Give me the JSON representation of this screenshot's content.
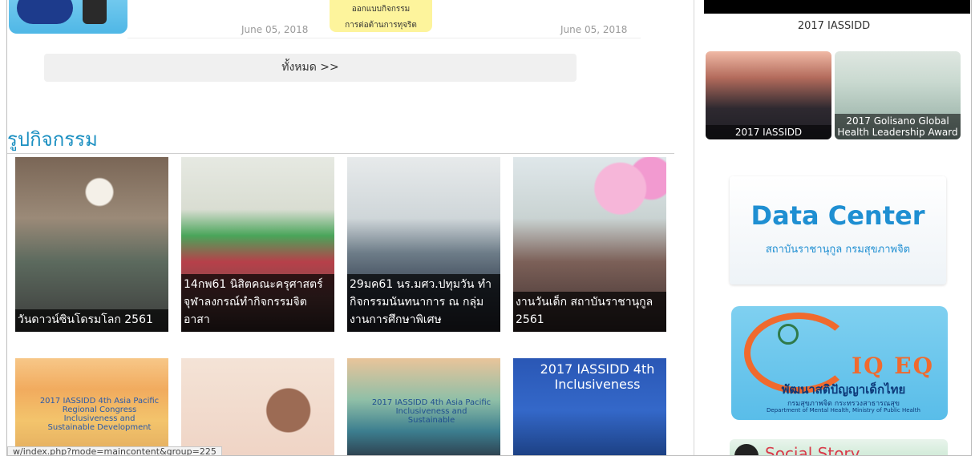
{
  "news": {
    "date_left": "June 05, 2018",
    "date_right": "June 05, 2018",
    "badge_line1": "ออกแบบกิจกรรม",
    "badge_line2": "การต่อต้านการทุจริต"
  },
  "all_button": "ทั้งหมด >>",
  "section_title": "รูปกิจกรรม",
  "gallery": {
    "row1": [
      {
        "caption": "วันดาวน์ซินโดรมโลก 2561"
      },
      {
        "caption": "14กพ61 นิสิตคณะครุศาสตร์ จุฬาลงกรณ์ทำกิจกรรมจิตอาสา"
      },
      {
        "caption": "29มค61 นร.มศว.ปทุมวัน ทำกิจกรรมนันทนาการ ณ กลุ่มงานการศึกษาพิเศษ"
      },
      {
        "caption": "งานวันเด็ก สถาบันราชานุกูล 2561"
      }
    ],
    "row2_banner_texts": [
      "2017 IASSIDD 4th Asia Pacific Regional Congress Inclusiveness and Sustainable Development",
      "2017 IASSIDD 4th Asia Pacific Inclusiveness and Sustainable",
      "2017 IASSIDD 4th Inclusiveness"
    ]
  },
  "sidebar": {
    "title": "2017 IASSIDD",
    "thumbs": [
      {
        "label": "2017 IASSIDD"
      },
      {
        "label": "2017 Golisano Global Health Leadership Award"
      }
    ],
    "data_center_title": "Data Center",
    "data_center_sub": "สถาบันราชานุกูล กรมสุขภาพจิต",
    "iqeq_logo": "IQ EQ",
    "iqeq_title": "พัฒนาสติปัญญาเด็กไทย",
    "iqeq_sub": "กรมสุขภาพจิต กระทรวงสาธารณสุข",
    "iqeq_en": "Department of Mental Health, Ministry of Public Health",
    "social_text": "Social Story"
  },
  "status_url": "w/index.php?mode=maincontent&group=225"
}
